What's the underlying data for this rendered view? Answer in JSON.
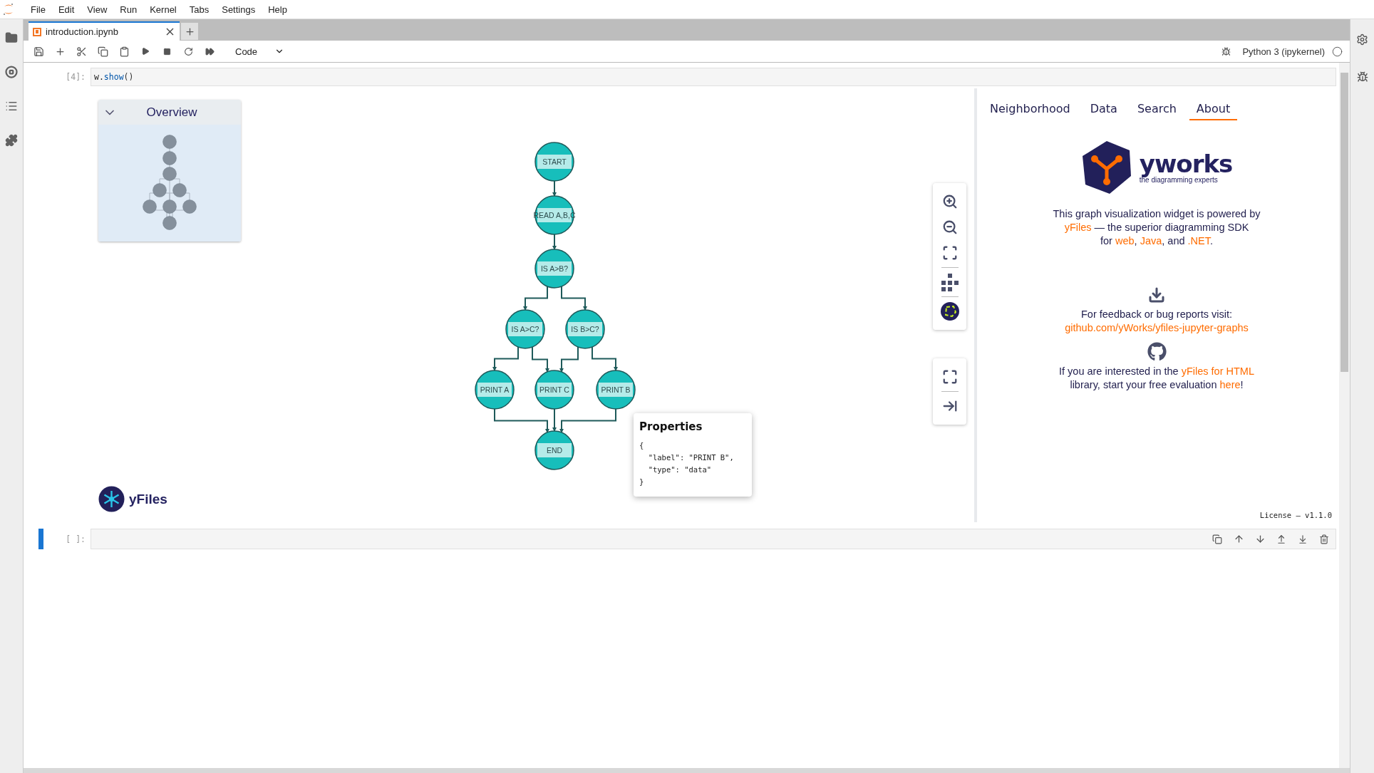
{
  "menu": [
    "File",
    "Edit",
    "View",
    "Run",
    "Kernel",
    "Tabs",
    "Settings",
    "Help"
  ],
  "tab": {
    "title": "introduction.ipynb"
  },
  "toolbar": {
    "cell_type": "Code",
    "kernel": "Python 3 (ipykernel)"
  },
  "cell": {
    "prompt": "[4]:",
    "code": [
      {
        "kind": "name",
        "text": "w."
      },
      {
        "kind": "call",
        "text": "show"
      },
      {
        "kind": "paren",
        "text": "()"
      }
    ]
  },
  "widget": {
    "overview": {
      "title": "Overview",
      "expanded": true
    },
    "graph": {
      "nodes": [
        {
          "label": "START"
        },
        {
          "label": "READ A,B,C"
        },
        {
          "label": "IS A>B?"
        },
        {
          "label": "IS A>C?"
        },
        {
          "label": "IS B>C?"
        },
        {
          "label": "PRINT A"
        },
        {
          "label": "PRINT C"
        },
        {
          "label": "PRINT B"
        },
        {
          "label": "END"
        }
      ]
    },
    "properties": {
      "title": "Properties",
      "lines": [
        "{",
        "  \"label\": \"PRINT B\",",
        "  \"type\": \"data\"",
        "}"
      ]
    },
    "brand": "yFiles",
    "side_tabs": [
      {
        "label": "Neighborhood",
        "selected": false
      },
      {
        "label": "Data",
        "selected": false
      },
      {
        "label": "Search",
        "selected": false
      },
      {
        "label": "About",
        "selected": true
      }
    ],
    "about": {
      "logo_name": "yworks",
      "logo_tagline": "the diagramming experts",
      "intro": [
        [
          {
            "text": "This graph visualization widget is powered by"
          }
        ],
        [
          {
            "text": "yFiles",
            "link": true
          },
          {
            "text": " — the superior diagramming SDK"
          }
        ],
        [
          {
            "text": "for "
          },
          {
            "text": "web",
            "link": true
          },
          {
            "text": ", "
          },
          {
            "text": "Java",
            "link": true
          },
          {
            "text": ", and "
          },
          {
            "text": ".NET",
            "link": true
          },
          {
            "text": "."
          }
        ]
      ],
      "feedback": [
        [
          {
            "text": "For feedback or bug reports visit:"
          }
        ],
        [
          {
            "text": "github.com/yWorks/yfiles-jupyter-graphs",
            "link": true
          }
        ]
      ],
      "evaluation": [
        [
          {
            "text": "If you are interested in the "
          },
          {
            "text": "yFiles for HTML",
            "link": true
          }
        ],
        [
          {
            "text": "library, start your free evaluation "
          },
          {
            "text": "here",
            "link": true
          },
          {
            "text": "!"
          }
        ]
      ]
    },
    "license": "License – v1.1.0"
  },
  "next_cell": {
    "prompt": "[ ]:",
    "active": true
  }
}
